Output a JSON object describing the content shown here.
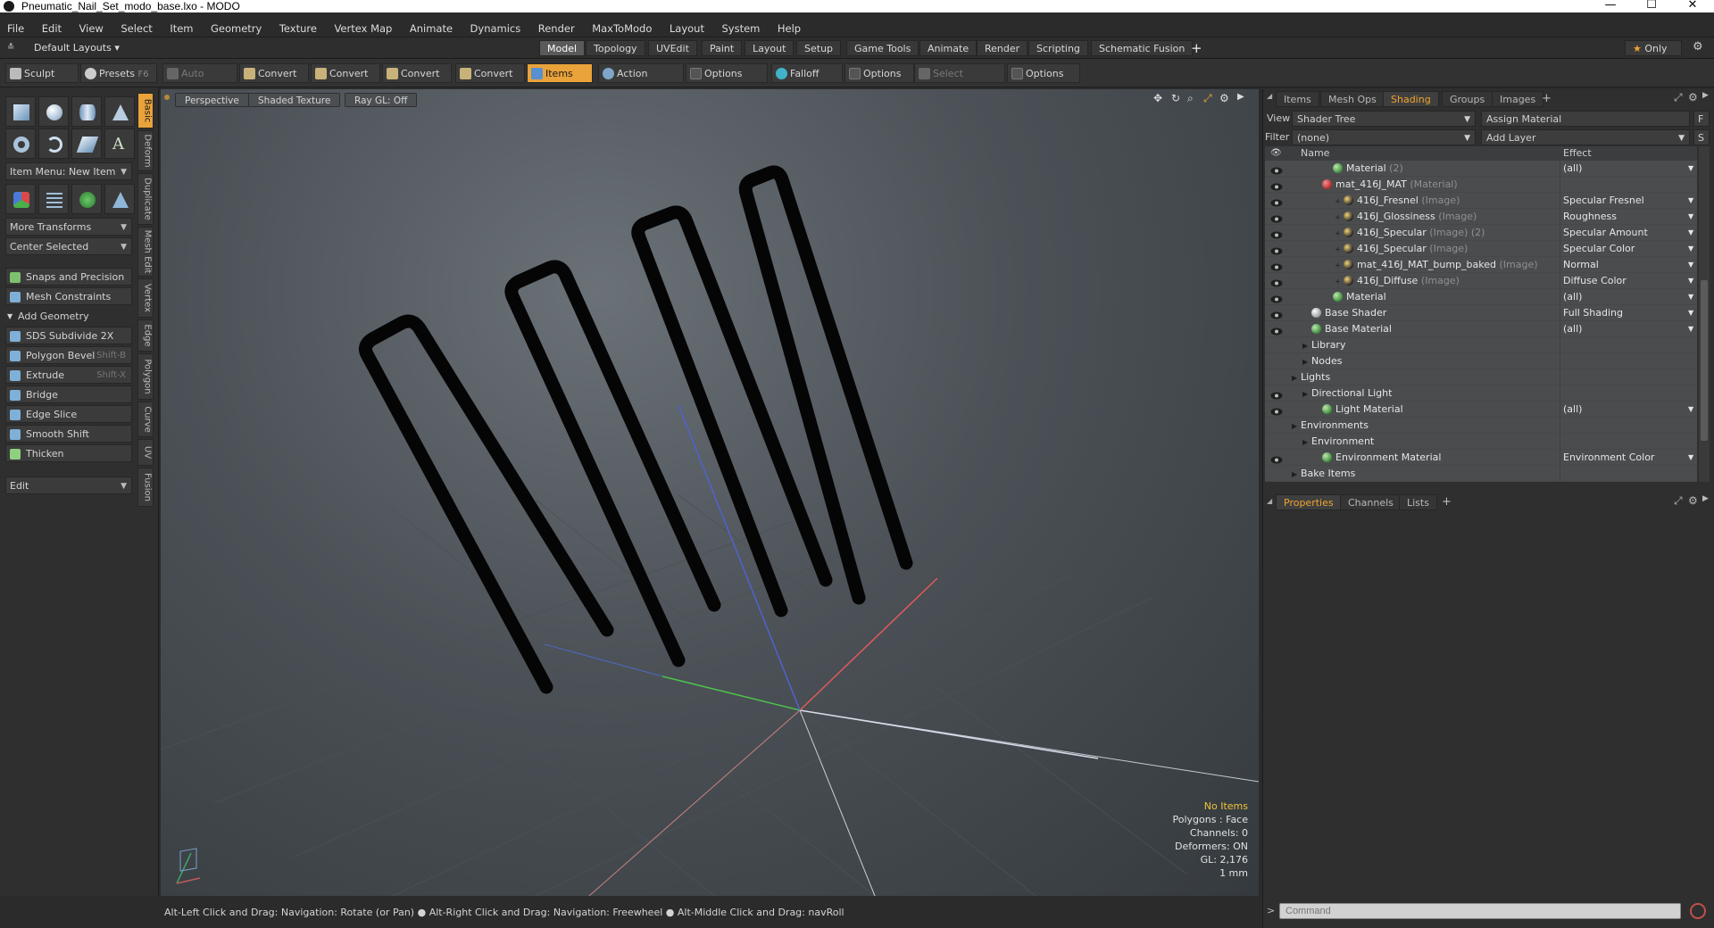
{
  "window": {
    "title": "Pneumatic_Nail_Set_modo_base.lxo - MODO",
    "controls": [
      "—",
      "☐",
      "✕"
    ]
  },
  "menu": [
    "File",
    "Edit",
    "View",
    "Select",
    "Item",
    "Geometry",
    "Texture",
    "Vertex Map",
    "Animate",
    "Dynamics",
    "Render",
    "MaxToModo",
    "Layout",
    "System",
    "Help"
  ],
  "layoutbar": {
    "layout_label": "Default Layouts",
    "tabs": [
      "Model",
      "Topology",
      "UVEdit",
      "Paint",
      "Layout",
      "Setup",
      "Game Tools",
      "Animate",
      "Render",
      "Scripting",
      "Schematic Fusion"
    ],
    "active_tab": "Model",
    "add": "+",
    "only_label": "Only"
  },
  "toolbar": {
    "sculpt": "Sculpt",
    "presets": "Presets",
    "presets_key": "F6",
    "auto_select": "Auto Select",
    "convert": "Convert",
    "items": "Items",
    "action_center": "Action Center",
    "options": "Options",
    "falloff": "Falloff",
    "select_through": "Select Through"
  },
  "leftpanel": {
    "vtabs": [
      "Basic",
      "Deform",
      "Duplicate",
      "Mesh Edit",
      "Vertex",
      "Edge",
      "Polygon",
      "Curve",
      "UV",
      "Fusion"
    ],
    "item_menu": "Item Menu: New Item",
    "more_transforms": "More Transforms",
    "center_selected": "Center Selected",
    "snaps": "Snaps and Precision",
    "mesh_constraints": "Mesh Constraints",
    "add_geometry": "Add Geometry",
    "tools": [
      {
        "label": "SDS Subdivide 2X",
        "key": ""
      },
      {
        "label": "Polygon Bevel",
        "key": "Shift-B"
      },
      {
        "label": "Extrude",
        "key": "Shift-X"
      },
      {
        "label": "Bridge",
        "key": ""
      },
      {
        "label": "Edge Slice",
        "key": ""
      },
      {
        "label": "Smooth Shift",
        "key": ""
      },
      {
        "label": "Thicken",
        "key": ""
      }
    ],
    "edit": "Edit"
  },
  "viewport": {
    "perspective": "Perspective",
    "shaded": "Shaded Texture",
    "raygl": "Ray GL: Off",
    "info": {
      "no_items": "No Items",
      "polygons": "Polygons : Face",
      "channels": "Channels: 0",
      "deformers": "Deformers: ON",
      "gl": "GL: 2,176",
      "scale": "1 mm"
    }
  },
  "status": "Alt-Left Click and Drag: Navigation: Rotate (or Pan) ● Alt-Right Click and Drag: Navigation: Freewheel ● Alt-Middle Click and Drag: navRoll",
  "rightpanel": {
    "tabs": [
      "Items",
      "Mesh Ops",
      "Shading",
      "Groups",
      "Images"
    ],
    "active_tab": "Shading",
    "view_label": "View",
    "view_value": "Shader Tree",
    "assign_material": "Assign Material",
    "filter_label": "Filter",
    "filter_value": "(none)",
    "add_layer": "Add Layer",
    "col_name": "Name",
    "col_effect": "Effect",
    "rows": [
      {
        "eye": true,
        "indent": 3,
        "ball": "g",
        "name": "Material",
        "sub": "(2)",
        "effect": "(all)",
        "arrow": true
      },
      {
        "eye": true,
        "indent": 2,
        "ball": "r",
        "name": "mat_416J_MAT",
        "sub": "(Material)",
        "effect": "",
        "arrow": false
      },
      {
        "eye": true,
        "indent": 4,
        "ball": "y",
        "name": "416J_Fresnel",
        "sub": "(Image)",
        "effect": "Specular Fresnel",
        "arrow": true
      },
      {
        "eye": true,
        "indent": 4,
        "ball": "y",
        "name": "416J_Glossiness",
        "sub": "(Image)",
        "effect": "Roughness",
        "arrow": true
      },
      {
        "eye": true,
        "indent": 4,
        "ball": "y",
        "name": "416J_Specular",
        "sub": "(Image) (2)",
        "effect": "Specular Amount",
        "arrow": true
      },
      {
        "eye": true,
        "indent": 4,
        "ball": "y",
        "name": "416J_Specular",
        "sub": "(Image)",
        "effect": "Specular Color",
        "arrow": true
      },
      {
        "eye": true,
        "indent": 4,
        "ball": "y",
        "name": "mat_416J_MAT_bump_baked",
        "sub": "(Image)",
        "effect": "Normal",
        "arrow": true
      },
      {
        "eye": true,
        "indent": 4,
        "ball": "y",
        "name": "416J_Diffuse",
        "sub": "(Image)",
        "effect": "Diffuse Color",
        "arrow": true
      },
      {
        "eye": true,
        "indent": 3,
        "ball": "g",
        "name": "Material",
        "sub": "",
        "effect": "(all)",
        "arrow": true
      },
      {
        "eye": true,
        "indent": 1,
        "ball": "w",
        "name": "Base Shader",
        "sub": "",
        "effect": "Full Shading",
        "arrow": true
      },
      {
        "eye": true,
        "indent": 1,
        "ball": "g",
        "name": "Base Material",
        "sub": "",
        "effect": "(all)",
        "arrow": true
      },
      {
        "eye": false,
        "indent": 1,
        "ball": "",
        "name": "Library",
        "sub": "",
        "effect": "",
        "arrow": false
      },
      {
        "eye": false,
        "indent": 1,
        "ball": "",
        "name": "Nodes",
        "sub": "",
        "effect": "",
        "arrow": false
      },
      {
        "eye": false,
        "indent": 0,
        "ball": "",
        "name": "Lights",
        "sub": "",
        "effect": "",
        "arrow": false
      },
      {
        "eye": true,
        "indent": 1,
        "ball": "",
        "name": "Directional Light",
        "sub": "",
        "effect": "",
        "arrow": false
      },
      {
        "eye": true,
        "indent": 2,
        "ball": "g",
        "name": "Light Material",
        "sub": "",
        "effect": "(all)",
        "arrow": true
      },
      {
        "eye": false,
        "indent": 0,
        "ball": "",
        "name": "Environments",
        "sub": "",
        "effect": "",
        "arrow": false
      },
      {
        "eye": false,
        "indent": 1,
        "ball": "",
        "name": "Environment",
        "sub": "",
        "effect": "",
        "arrow": false
      },
      {
        "eye": true,
        "indent": 2,
        "ball": "g",
        "name": "Environment Material",
        "sub": "",
        "effect": "Environment Color",
        "arrow": true
      },
      {
        "eye": false,
        "indent": 0,
        "ball": "",
        "name": "Bake Items",
        "sub": "",
        "effect": "",
        "arrow": false
      }
    ],
    "props_tabs": [
      "Properties",
      "Channels",
      "Lists"
    ],
    "props_active": "Properties",
    "command_placeholder": "Command"
  },
  "colors": {
    "accent": "#e9a33a",
    "active_tab_text": "#f0a42e",
    "info_warn": "#f0c23a"
  }
}
